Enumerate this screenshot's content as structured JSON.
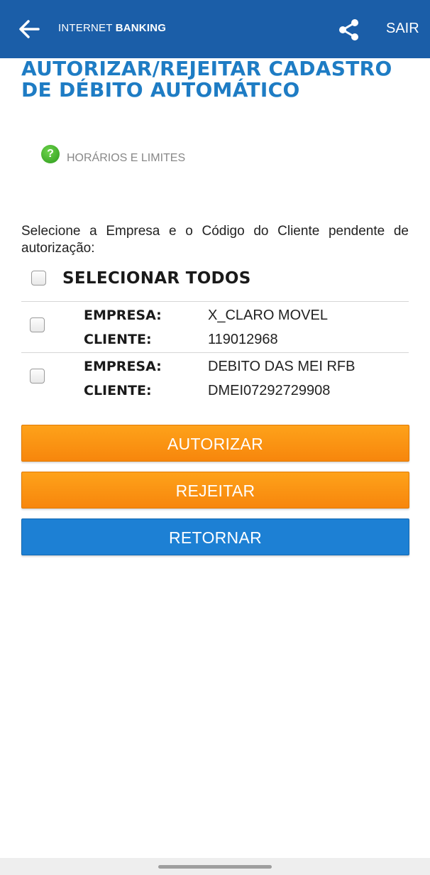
{
  "header": {
    "brand_light": "INTERNET ",
    "brand_bold": "BANKING",
    "exit_label": "SAIR",
    "background_color": "#1b5ea8",
    "back_icon": "arrow-left-icon",
    "share_icon": "share-icon"
  },
  "page": {
    "title": "AUTORIZAR/REJEITAR CADASTRO DE DÉBITO AUTOMÁTICO",
    "title_color": "#1e7cc4",
    "help_icon_glyph": "?",
    "help_link": "HORÁRIOS E LIMITES",
    "instruction": "Selecione a Empresa e o Código do Cliente pendente de autorização:",
    "select_all_label": "SELECIONAR TODOS"
  },
  "items": [
    {
      "company_label": "EMPRESA:",
      "company": "X_CLARO MOVEL",
      "client_label": "CLIENTE:",
      "client": "119012968"
    },
    {
      "company_label": "EMPRESA:",
      "company": "DEBITO DAS MEI RFB",
      "client_label": "CLIENTE:",
      "client": "DMEI07292729908"
    }
  ],
  "actions": {
    "authorize_label": "AUTORIZAR",
    "reject_label": "REJEITAR",
    "return_label": "RETORNAR",
    "orange_color": "#f7910f",
    "blue_color": "#1d80d4"
  }
}
